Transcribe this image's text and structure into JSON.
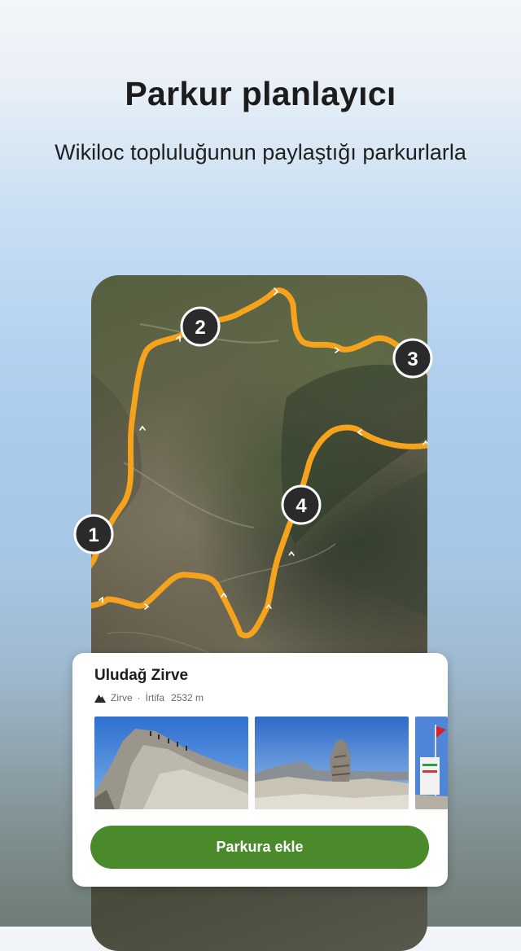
{
  "header": {
    "title": "Parkur planlayıcı",
    "subtitle": "Wikiloc topluluğunun paylaştığı parkurlarla"
  },
  "map": {
    "route_color": "#f5a21c",
    "waypoints": [
      {
        "label": "1"
      },
      {
        "label": "2"
      },
      {
        "label": "3"
      },
      {
        "label": "4"
      }
    ]
  },
  "card": {
    "title": "Uludağ Zirve",
    "type_icon": "mountain-icon",
    "type": "Zirve",
    "separator": "·",
    "altitude_label": "İrtifa",
    "altitude_value": "2532 m",
    "photos": [
      "rocky-ridge-hikers",
      "stone-cairn-summit",
      "summit-flag-sign"
    ],
    "button_label": "Parkura ekle",
    "button_color": "#4a8a2b"
  }
}
